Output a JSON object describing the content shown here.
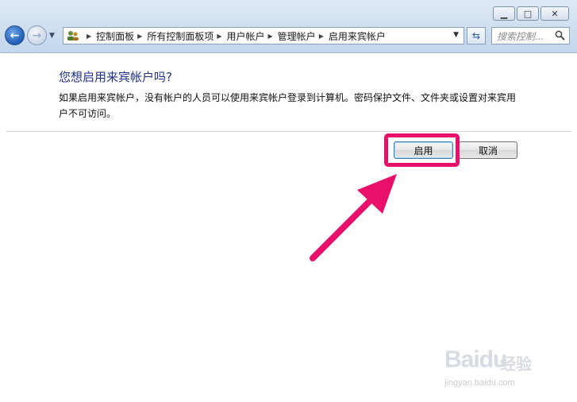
{
  "window": {
    "minimize_glyph": "▁",
    "maximize_glyph": "□",
    "close_glyph": "✕"
  },
  "nav": {
    "back_icon": "back-arrow-icon",
    "forward_icon": "forward-arrow-icon",
    "history_icon": "chevron-down-icon"
  },
  "address": {
    "breadcrumbs": [
      "控制面板",
      "所有控制面板项",
      "用户帐户",
      "管理帐户",
      "启用来宾帐户"
    ]
  },
  "search": {
    "placeholder": "搜索控制..."
  },
  "content": {
    "question": "您想启用来宾帐户吗?",
    "description": "如果启用来宾帐户，没有帐户的人员可以使用来宾帐户登录到计算机。密码保护文件、文件夹或设置对来宾用户不可访问。"
  },
  "buttons": {
    "enable_label": "启用",
    "cancel_label": "取消"
  },
  "annotation": {
    "highlight_color": "#e8106a"
  },
  "watermark": {
    "brand": "Baidu",
    "service": "经验",
    "url": "jingyan.baidu.com"
  }
}
